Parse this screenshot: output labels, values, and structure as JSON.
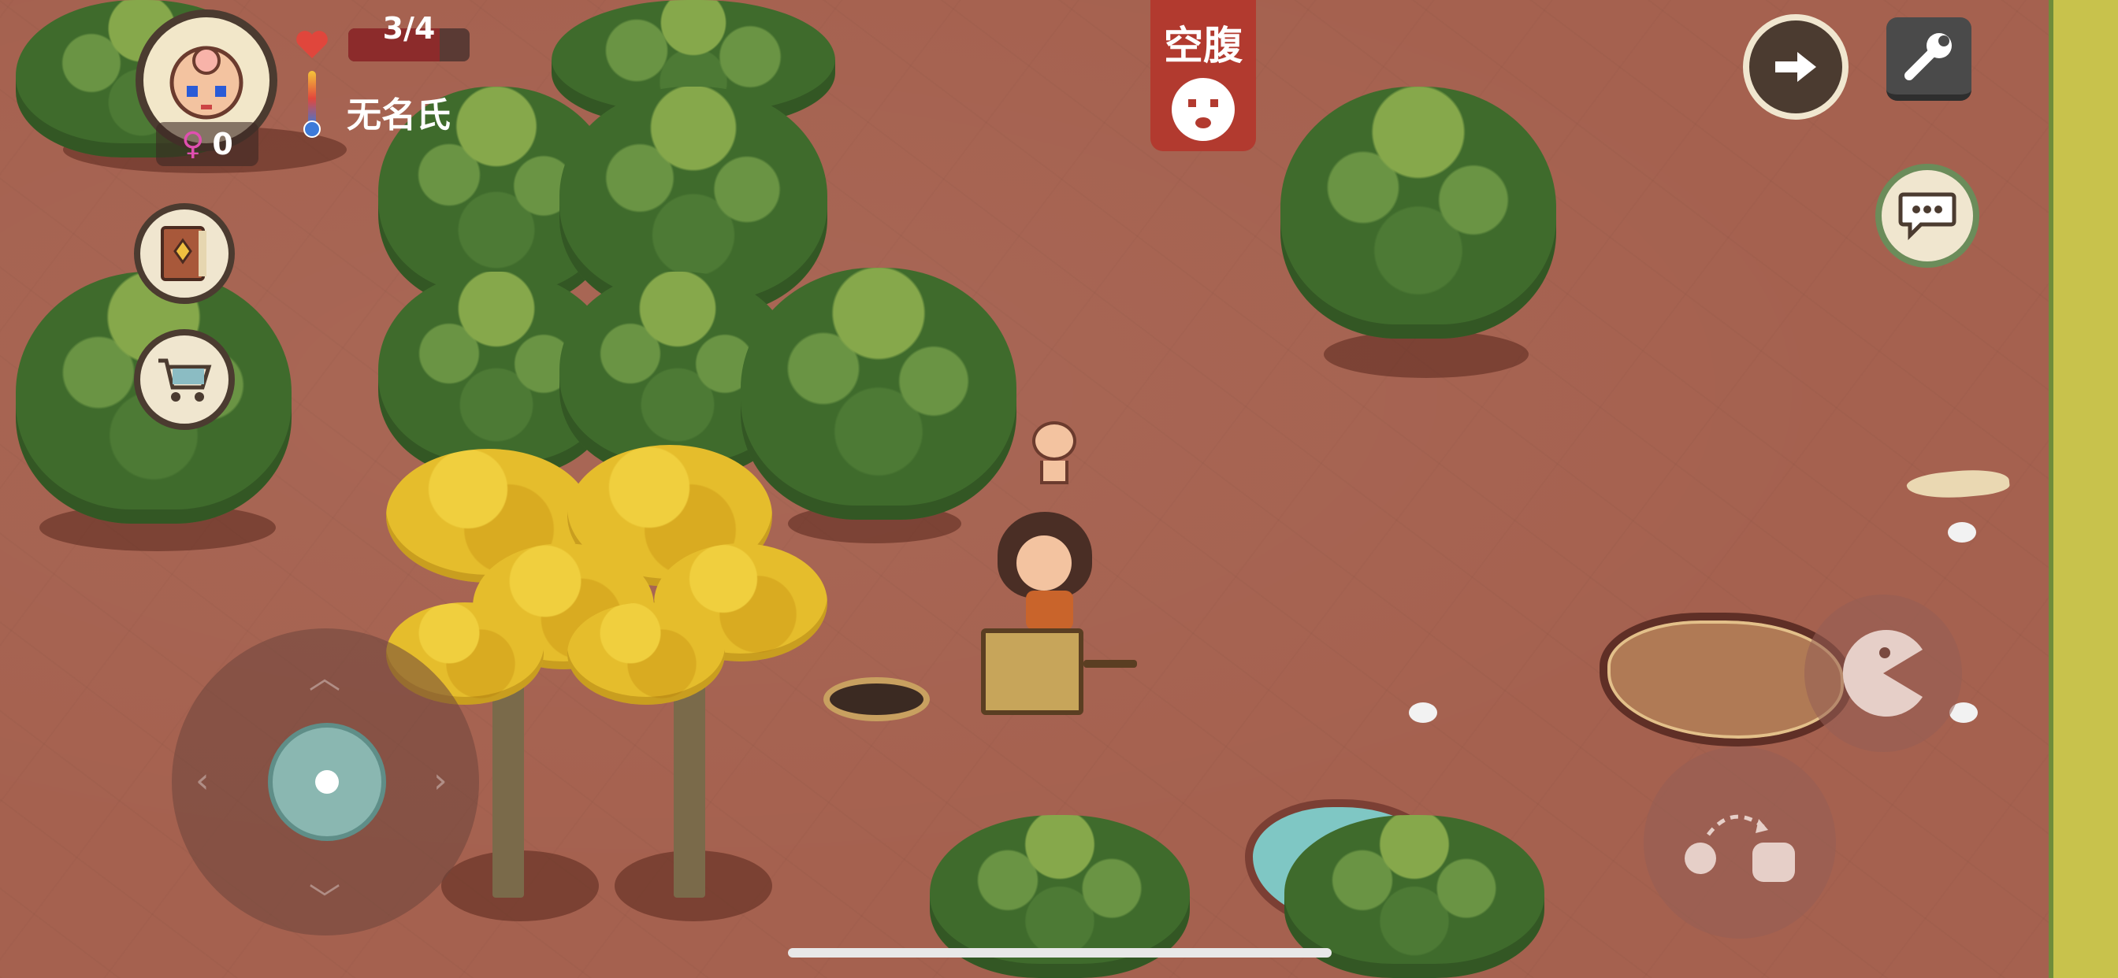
{
  "hud": {
    "health": "3/4",
    "player_name": "无名氏",
    "gender_symbol": "♀",
    "child_count": "0",
    "status_label": "空腹"
  },
  "icons": {
    "heart": "heart-icon",
    "thermometer": "thermometer-icon",
    "recipe_book": "recipe-book-icon",
    "shop": "shopping-cart-icon",
    "next": "arrow-right-icon",
    "settings": "wrench-icon",
    "chat": "speech-bubble-icon",
    "hunger": "hungry-face-icon",
    "eat": "eat-icon",
    "throw": "throw-icon"
  },
  "colors": {
    "ground": "#a5614f",
    "health_bar": "#8c2b2b",
    "status_badge": "#b23a2f",
    "grass": "#c8c24c"
  },
  "health_fraction": 0.75
}
